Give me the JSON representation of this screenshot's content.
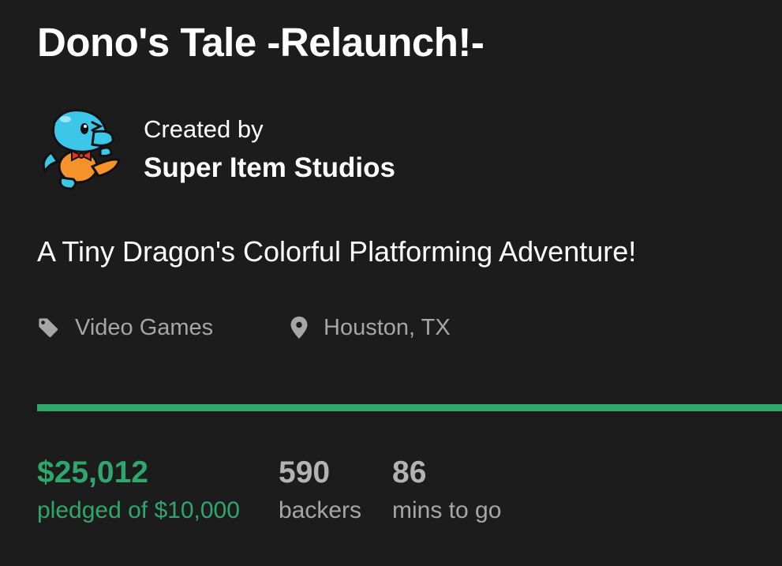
{
  "project": {
    "title": "Dono's Tale -Relaunch!-",
    "blurb": "A Tiny Dragon's Colorful Platforming Adventure!"
  },
  "creator": {
    "created_by_label": "Created by",
    "name": "Super Item Studios",
    "avatar_icon": "blue-dragon-mascot-icon"
  },
  "meta": {
    "category": "Video Games",
    "category_icon": "tag-icon",
    "location": "Houston, TX",
    "location_icon": "location-pin-icon"
  },
  "funding": {
    "progress_percent": 100,
    "pledged": "$25,012",
    "pledged_label": "pledged of $10,000",
    "backers": "590",
    "backers_label": "backers",
    "time_left": "86",
    "time_left_label": "mins to go"
  },
  "colors": {
    "background": "#1c1c1c",
    "accent_green": "#2fa66c",
    "muted_text": "#a6a6a6"
  }
}
